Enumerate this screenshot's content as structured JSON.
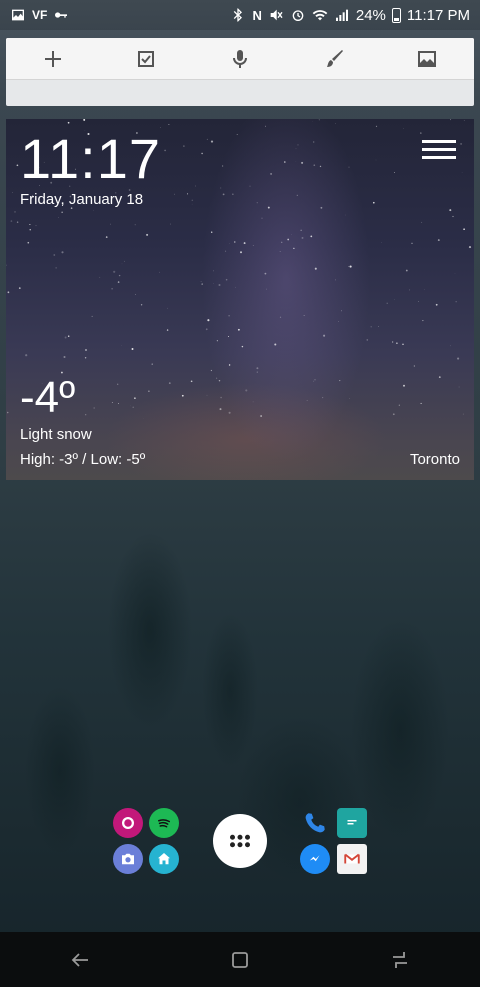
{
  "status_bar": {
    "battery_percent": "24%",
    "time": "11:17 PM",
    "left_icons": [
      "image-icon",
      "vf-icon",
      "key-icon"
    ],
    "right_icons": [
      "bluetooth-icon",
      "nfc-icon",
      "mute-icon",
      "alarm-icon",
      "wifi-icon",
      "signal-icon",
      "battery-icon"
    ]
  },
  "notes_toolbar": {
    "buttons": [
      "add-icon",
      "checkbox-icon",
      "microphone-icon",
      "brush-icon",
      "image-icon"
    ]
  },
  "weather": {
    "time": "11:17",
    "date": "Friday, January 18",
    "temperature": "-4º",
    "condition": "Light snow",
    "high_low": "High: -3º / Low: -5º",
    "city": "Toronto"
  },
  "dock": {
    "left_apps": [
      {
        "icon": "firefox-icon",
        "color": "#c2187a"
      },
      {
        "icon": "spotify-icon",
        "color": "#1db954"
      },
      {
        "icon": "camera-icon",
        "color": "#6b7fd8"
      },
      {
        "icon": "home-icon",
        "color": "#26b3d1"
      }
    ],
    "right_apps": [
      {
        "icon": "phone-icon",
        "color": "#2e86e8"
      },
      {
        "icon": "messages-icon",
        "color": "#1fa5a0"
      },
      {
        "icon": "messenger-icon",
        "color": "#1f8cf5"
      },
      {
        "icon": "gmail-icon",
        "color": "#d44638"
      }
    ]
  },
  "nav_bar": {
    "buttons": [
      "back-icon",
      "home-button-icon",
      "recents-icon"
    ]
  }
}
